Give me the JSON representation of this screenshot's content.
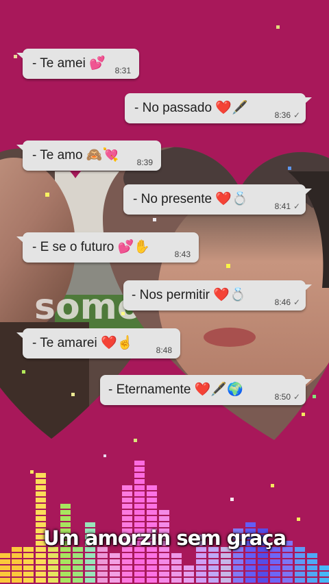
{
  "colors": {
    "background": "#a8185a",
    "bubble": "#e4e4e4",
    "heart": "#c81e6a"
  },
  "messages": [
    {
      "text": "- Te amei",
      "emoji": "💕",
      "time": "8:31",
      "direction": "in",
      "check": false
    },
    {
      "text": "- No passado",
      "emoji": "❤️🖋️",
      "time": "8:36",
      "direction": "out",
      "check": true
    },
    {
      "text": "- Te amo",
      "emoji": "🙈💘",
      "time": "8:39",
      "direction": "in",
      "check": false
    },
    {
      "text": "- No presente",
      "emoji": "❤️💍",
      "time": "8:41",
      "direction": "out",
      "check": true
    },
    {
      "text": "- E se o futuro",
      "emoji": "💕✋",
      "time": "8:43",
      "direction": "in",
      "check": false
    },
    {
      "text": "- Nos permitir",
      "emoji": "❤️💍",
      "time": "8:46",
      "direction": "out",
      "check": true
    },
    {
      "text": "- Te amarei",
      "emoji": "❤️☝️",
      "time": "8:48",
      "direction": "in",
      "check": false
    },
    {
      "text": "- Eternamente",
      "emoji": "❤️🖋️🌍",
      "time": "8:50",
      "direction": "out",
      "check": true
    }
  ],
  "check_mark": "✓",
  "background_photo_text": "somo",
  "caption": "Um amorzin sem graça"
}
